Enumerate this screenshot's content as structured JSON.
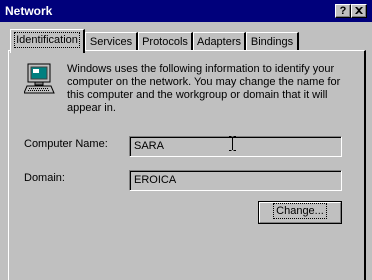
{
  "window": {
    "title": "Network",
    "help_label": "?",
    "close_icon": "close-icon"
  },
  "tabs": [
    {
      "label": "Identification",
      "active": true
    },
    {
      "label": "Services",
      "active": false
    },
    {
      "label": "Protocols",
      "active": false
    },
    {
      "label": "Adapters",
      "active": false
    },
    {
      "label": "Bindings",
      "active": false
    }
  ],
  "identification": {
    "icon": "network-computer-icon",
    "description": "Windows uses the following information to identify your computer on the network.  You may change the name for this computer and the workgroup or domain that it will appear in.",
    "computer_name_label": "Computer Name:",
    "computer_name_value": "SARA",
    "domain_label": "Domain:",
    "domain_value": "EROICA",
    "change_button": "Change..."
  },
  "colors": {
    "titlebar": "#00007b",
    "face": "#c0c0c0"
  }
}
